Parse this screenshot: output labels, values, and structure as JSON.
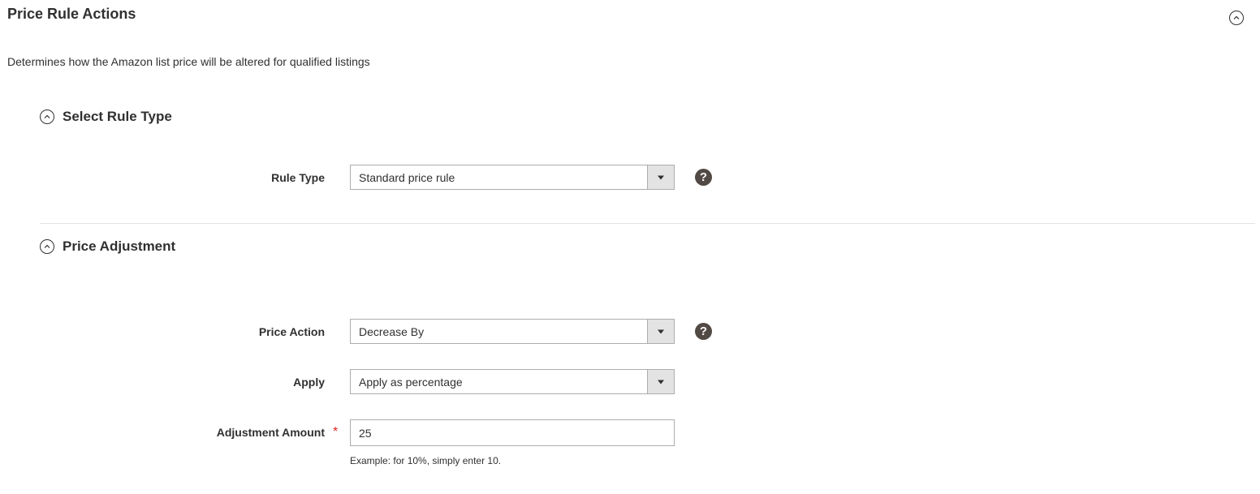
{
  "panel": {
    "title": "Price Rule Actions",
    "description": "Determines how the Amazon list price will be altered for qualified listings"
  },
  "sections": {
    "rule_type": {
      "title": "Select Rule Type",
      "fields": {
        "rule_type": {
          "label": "Rule Type",
          "value": "Standard price rule"
        }
      }
    },
    "price_adjustment": {
      "title": "Price Adjustment",
      "fields": {
        "price_action": {
          "label": "Price Action",
          "value": "Decrease By"
        },
        "apply": {
          "label": "Apply",
          "value": "Apply as percentage"
        },
        "adjustment_amount": {
          "label": "Adjustment Amount",
          "value": "25",
          "required_marker": "*",
          "note": "Example: for 10%, simply enter 10."
        }
      }
    }
  },
  "icons": {
    "help": "?",
    "collapse": "chevron-up-circle-icon",
    "dropdown": "triangle-down-icon"
  },
  "colors": {
    "text": "#303030",
    "help_bg": "#514943",
    "required": "#e22626",
    "border": "#adadad",
    "divider": "#e3e3e3"
  }
}
